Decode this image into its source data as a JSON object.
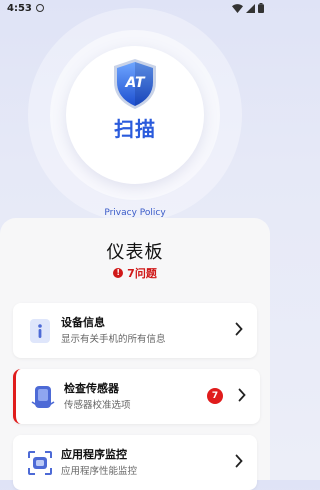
{
  "status_bar": {
    "time": "4:53",
    "icons": [
      "app-indicator-icon",
      "wifi-icon",
      "signal-icon",
      "battery-icon"
    ]
  },
  "scan": {
    "logo_text": "AT",
    "label": "扫描"
  },
  "privacy_link": "Privacy Policy",
  "dashboard": {
    "title": "仪表板",
    "issues_text": "7问题",
    "issues_color": "#d01818"
  },
  "cards": [
    {
      "title": "设备信息",
      "subtitle": "显示有关手机的所有信息",
      "icon": "info-icon",
      "badge": ""
    },
    {
      "title": "检查传感器",
      "subtitle": "传感器校准选项",
      "icon": "sensor-icon",
      "badge": "7"
    },
    {
      "title": "应用程序监控",
      "subtitle": "应用程序性能监控",
      "icon": "app-monitor-icon",
      "badge": ""
    }
  ],
  "colors": {
    "accent": "#2a5bdc",
    "alert": "#e01c1c",
    "icon_blue": "#4d6ad6"
  }
}
